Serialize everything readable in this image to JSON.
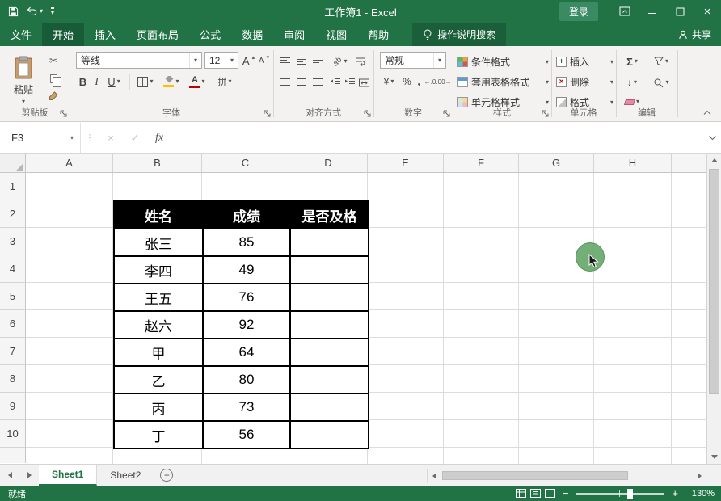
{
  "icons": {
    "caret": "▾",
    "scissors": "✂",
    "check": "✓",
    "cancel": "×",
    "fx": "fx",
    "sigma": "Σ",
    "fill_down": "↓",
    "letter_a": "A",
    "accounting": "¥",
    "percent": "%",
    "comma": ",",
    "increase_decimal": "←.0",
    "decrease_decimal": ".00→",
    "plus": "+",
    "delete_x": "×",
    "orientation": "ab",
    "splitter_dots": "⋮"
  },
  "title_bar": {
    "title": "工作簿1 - Excel",
    "sign_in": "登录"
  },
  "ribbon_tabs": {
    "items": [
      {
        "label": "文件"
      },
      {
        "label": "开始",
        "active": true
      },
      {
        "label": "插入"
      },
      {
        "label": "页面布局"
      },
      {
        "label": "公式"
      },
      {
        "label": "数据"
      },
      {
        "label": "审阅"
      },
      {
        "label": "视图"
      },
      {
        "label": "帮助"
      }
    ],
    "tell_me": "操作说明搜索",
    "share": "共享"
  },
  "ribbon": {
    "clipboard": {
      "label": "剪贴板",
      "paste": "粘贴"
    },
    "font": {
      "label": "字体",
      "name": "等线",
      "size": "12",
      "bold": "B",
      "italic": "I",
      "underline": "U",
      "phonetic": "拼"
    },
    "alignment": {
      "label": "对齐方式"
    },
    "number": {
      "label": "数字",
      "format": "常规"
    },
    "styles": {
      "label": "样式",
      "conditional": "条件格式",
      "format_table": "套用表格格式",
      "cell_styles": "单元格样式"
    },
    "cells": {
      "label": "单元格",
      "insert": "插入",
      "delete": "删除",
      "format": "格式"
    },
    "editing": {
      "label": "编辑"
    }
  },
  "formula_bar": {
    "name_box": "F3",
    "value": ""
  },
  "sheet": {
    "columns": [
      "A",
      "B",
      "C",
      "D",
      "E",
      "F",
      "G",
      "H"
    ],
    "row_numbers": [
      "1",
      "2",
      "3",
      "4",
      "5",
      "6",
      "7",
      "8",
      "9",
      "10"
    ],
    "table": {
      "headers": [
        "姓名",
        "成绩",
        "是否及格"
      ],
      "rows": [
        [
          "张三",
          "85",
          ""
        ],
        [
          "李四",
          "49",
          ""
        ],
        [
          "王五",
          "76",
          ""
        ],
        [
          "赵六",
          "92",
          ""
        ],
        [
          "甲",
          "64",
          ""
        ],
        [
          "乙",
          "80",
          ""
        ],
        [
          "丙",
          "73",
          ""
        ],
        [
          "丁",
          "56",
          ""
        ]
      ]
    }
  },
  "sheet_tabs": {
    "tabs": [
      {
        "label": "Sheet1",
        "active": true
      },
      {
        "label": "Sheet2"
      }
    ]
  },
  "status_bar": {
    "mode": "就绪",
    "zoom": "130%"
  }
}
